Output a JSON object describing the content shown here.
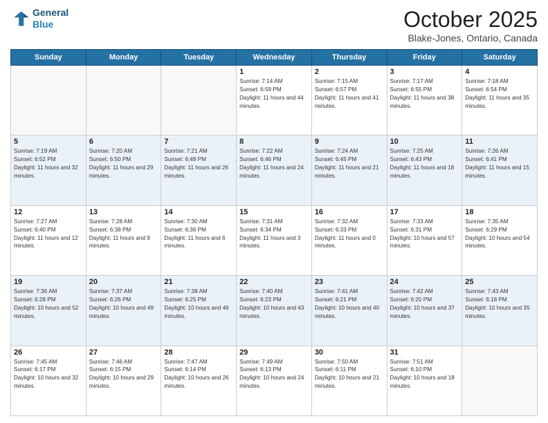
{
  "header": {
    "logo_line1": "General",
    "logo_line2": "Blue",
    "month": "October 2025",
    "location": "Blake-Jones, Ontario, Canada"
  },
  "days_of_week": [
    "Sunday",
    "Monday",
    "Tuesday",
    "Wednesday",
    "Thursday",
    "Friday",
    "Saturday"
  ],
  "weeks": [
    [
      {
        "day": "",
        "info": ""
      },
      {
        "day": "",
        "info": ""
      },
      {
        "day": "",
        "info": ""
      },
      {
        "day": "1",
        "info": "Sunrise: 7:14 AM\nSunset: 6:59 PM\nDaylight: 11 hours and 44 minutes."
      },
      {
        "day": "2",
        "info": "Sunrise: 7:15 AM\nSunset: 6:57 PM\nDaylight: 11 hours and 41 minutes."
      },
      {
        "day": "3",
        "info": "Sunrise: 7:17 AM\nSunset: 6:55 PM\nDaylight: 11 hours and 38 minutes."
      },
      {
        "day": "4",
        "info": "Sunrise: 7:18 AM\nSunset: 6:54 PM\nDaylight: 11 hours and 35 minutes."
      }
    ],
    [
      {
        "day": "5",
        "info": "Sunrise: 7:19 AM\nSunset: 6:52 PM\nDaylight: 11 hours and 32 minutes."
      },
      {
        "day": "6",
        "info": "Sunrise: 7:20 AM\nSunset: 6:50 PM\nDaylight: 11 hours and 29 minutes."
      },
      {
        "day": "7",
        "info": "Sunrise: 7:21 AM\nSunset: 6:48 PM\nDaylight: 11 hours and 26 minutes."
      },
      {
        "day": "8",
        "info": "Sunrise: 7:22 AM\nSunset: 6:46 PM\nDaylight: 11 hours and 24 minutes."
      },
      {
        "day": "9",
        "info": "Sunrise: 7:24 AM\nSunset: 6:45 PM\nDaylight: 11 hours and 21 minutes."
      },
      {
        "day": "10",
        "info": "Sunrise: 7:25 AM\nSunset: 6:43 PM\nDaylight: 11 hours and 18 minutes."
      },
      {
        "day": "11",
        "info": "Sunrise: 7:26 AM\nSunset: 6:41 PM\nDaylight: 11 hours and 15 minutes."
      }
    ],
    [
      {
        "day": "12",
        "info": "Sunrise: 7:27 AM\nSunset: 6:40 PM\nDaylight: 11 hours and 12 minutes."
      },
      {
        "day": "13",
        "info": "Sunrise: 7:28 AM\nSunset: 6:38 PM\nDaylight: 11 hours and 9 minutes."
      },
      {
        "day": "14",
        "info": "Sunrise: 7:30 AM\nSunset: 6:36 PM\nDaylight: 11 hours and 6 minutes."
      },
      {
        "day": "15",
        "info": "Sunrise: 7:31 AM\nSunset: 6:34 PM\nDaylight: 11 hours and 3 minutes."
      },
      {
        "day": "16",
        "info": "Sunrise: 7:32 AM\nSunset: 6:33 PM\nDaylight: 11 hours and 0 minutes."
      },
      {
        "day": "17",
        "info": "Sunrise: 7:33 AM\nSunset: 6:31 PM\nDaylight: 10 hours and 57 minutes."
      },
      {
        "day": "18",
        "info": "Sunrise: 7:35 AM\nSunset: 6:29 PM\nDaylight: 10 hours and 54 minutes."
      }
    ],
    [
      {
        "day": "19",
        "info": "Sunrise: 7:36 AM\nSunset: 6:28 PM\nDaylight: 10 hours and 52 minutes."
      },
      {
        "day": "20",
        "info": "Sunrise: 7:37 AM\nSunset: 6:26 PM\nDaylight: 10 hours and 49 minutes."
      },
      {
        "day": "21",
        "info": "Sunrise: 7:38 AM\nSunset: 6:25 PM\nDaylight: 10 hours and 46 minutes."
      },
      {
        "day": "22",
        "info": "Sunrise: 7:40 AM\nSunset: 6:23 PM\nDaylight: 10 hours and 43 minutes."
      },
      {
        "day": "23",
        "info": "Sunrise: 7:41 AM\nSunset: 6:21 PM\nDaylight: 10 hours and 40 minutes."
      },
      {
        "day": "24",
        "info": "Sunrise: 7:42 AM\nSunset: 6:20 PM\nDaylight: 10 hours and 37 minutes."
      },
      {
        "day": "25",
        "info": "Sunrise: 7:43 AM\nSunset: 6:18 PM\nDaylight: 10 hours and 35 minutes."
      }
    ],
    [
      {
        "day": "26",
        "info": "Sunrise: 7:45 AM\nSunset: 6:17 PM\nDaylight: 10 hours and 32 minutes."
      },
      {
        "day": "27",
        "info": "Sunrise: 7:46 AM\nSunset: 6:15 PM\nDaylight: 10 hours and 29 minutes."
      },
      {
        "day": "28",
        "info": "Sunrise: 7:47 AM\nSunset: 6:14 PM\nDaylight: 10 hours and 26 minutes."
      },
      {
        "day": "29",
        "info": "Sunrise: 7:49 AM\nSunset: 6:13 PM\nDaylight: 10 hours and 24 minutes."
      },
      {
        "day": "30",
        "info": "Sunrise: 7:50 AM\nSunset: 6:11 PM\nDaylight: 10 hours and 21 minutes."
      },
      {
        "day": "31",
        "info": "Sunrise: 7:51 AM\nSunset: 6:10 PM\nDaylight: 10 hours and 18 minutes."
      },
      {
        "day": "",
        "info": ""
      }
    ]
  ]
}
